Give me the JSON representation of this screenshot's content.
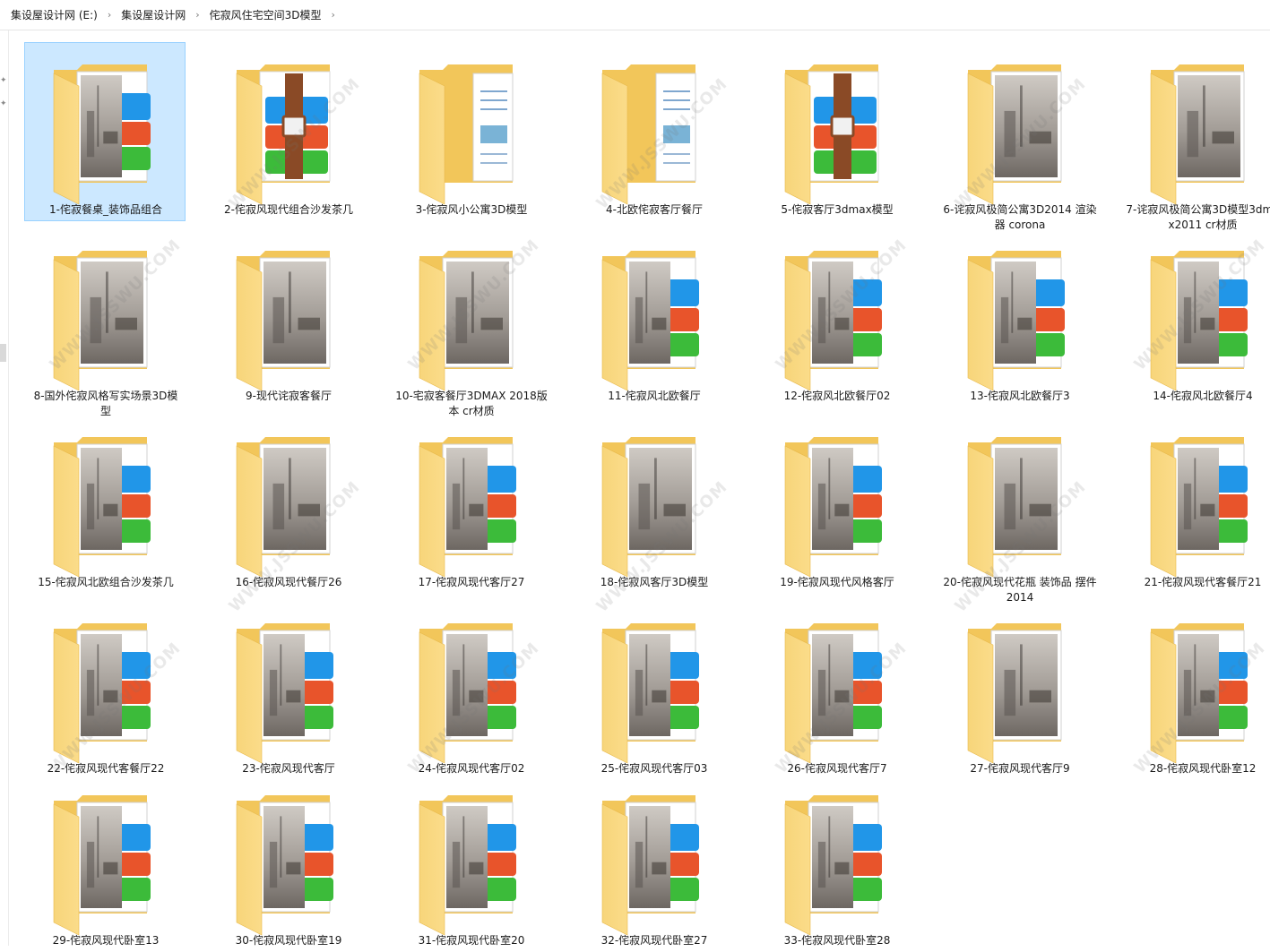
{
  "breadcrumb": [
    {
      "label": "集设屋设计网 (E:)"
    },
    {
      "label": "集设屋设计网"
    },
    {
      "label": "侘寂风住宅空间3D模型"
    }
  ],
  "colors": {
    "folder_back": "#f2c65a",
    "folder_front": "#fbdc8a",
    "rar_blue": "#2196e8",
    "rar_red": "#e8542b",
    "rar_green": "#3cbb3a",
    "rar_belt": "#8a4a26",
    "selection": "#cce8ff"
  },
  "items": [
    {
      "label": "1-侘寂餐桌_装饰品组合",
      "preview": "rar-photo",
      "selected": true
    },
    {
      "label": "2-侘寂风现代组合沙发茶几",
      "preview": "rar"
    },
    {
      "label": "3-侘寂风小公寓3D模型",
      "preview": "doc"
    },
    {
      "label": "4-北欧侘寂客厅餐厅",
      "preview": "doc"
    },
    {
      "label": "5-侘寂客厅3dmax模型",
      "preview": "rar"
    },
    {
      "label": "6-诧寂风极简公寓3D2014 渲染器 corona",
      "preview": "photo"
    },
    {
      "label": "7-诧寂风极简公寓3D模型3dmax2011 cr材质",
      "preview": "photo"
    },
    {
      "label": "8-国外侘寂风格写实场景3D模型",
      "preview": "photo"
    },
    {
      "label": "9-现代诧寂客餐厅",
      "preview": "photo"
    },
    {
      "label": "10-宅寂客餐厅3DMAX 2018版本 cr材质",
      "preview": "photo"
    },
    {
      "label": "11-侘寂风北欧餐厅",
      "preview": "rar-photo"
    },
    {
      "label": "12-侘寂风北欧餐厅02",
      "preview": "rar-photo"
    },
    {
      "label": "13-侘寂风北欧餐厅3",
      "preview": "rar-photo"
    },
    {
      "label": "14-侘寂风北欧餐厅4",
      "preview": "rar-photo"
    },
    {
      "label": "15-侘寂风北欧组合沙发茶几",
      "preview": "rar-photo"
    },
    {
      "label": "16-侘寂风现代餐厅26",
      "preview": "photo"
    },
    {
      "label": "17-侘寂风现代客厅27",
      "preview": "rar-photo"
    },
    {
      "label": "18-侘寂风客厅3D模型",
      "preview": "photo"
    },
    {
      "label": "19-侘寂风现代风格客厅",
      "preview": "rar-photo"
    },
    {
      "label": "20-侘寂风现代花瓶 装饰品 摆件2014",
      "preview": "photo"
    },
    {
      "label": "21-侘寂风现代客餐厅21",
      "preview": "rar-photo"
    },
    {
      "label": "22-侘寂风现代客餐厅22",
      "preview": "rar-photo"
    },
    {
      "label": "23-侘寂风现代客厅",
      "preview": "rar-photo"
    },
    {
      "label": "24-侘寂风现代客厅02",
      "preview": "rar-photo"
    },
    {
      "label": "25-侘寂风现代客厅03",
      "preview": "rar-photo"
    },
    {
      "label": "26-侘寂风现代客厅7",
      "preview": "rar-photo"
    },
    {
      "label": "27-侘寂风现代客厅9",
      "preview": "photo"
    },
    {
      "label": "28-侘寂风现代卧室12",
      "preview": "rar-photo"
    },
    {
      "label": "29-侘寂风现代卧室13",
      "preview": "rar-photo"
    },
    {
      "label": "30-侘寂风现代卧室19",
      "preview": "rar-photo"
    },
    {
      "label": "31-侘寂风现代卧室20",
      "preview": "rar-photo"
    },
    {
      "label": "32-侘寂风现代卧室27",
      "preview": "rar-photo"
    },
    {
      "label": "33-侘寂风现代卧室28",
      "preview": "rar-photo"
    }
  ]
}
